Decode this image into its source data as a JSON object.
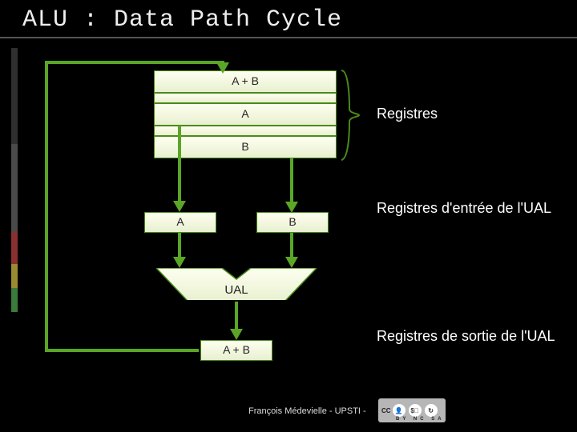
{
  "title": "ALU : Data Path Cycle",
  "registers": {
    "r0": "A + B",
    "r1": "A",
    "r2": "B",
    "label": "Registres"
  },
  "input_regs": {
    "a": "A",
    "b": "B",
    "label": "Registres d'entrée de l'UAL"
  },
  "ual": {
    "label": "UAL"
  },
  "output_reg": {
    "value": "A + B",
    "label": "Registres de sortie de l'UAL"
  },
  "footer": "François Médevielle - UPSTI -",
  "cc": {
    "prefix": "CC",
    "terms": "BY NC SA"
  },
  "colors": {
    "green": "#5aa626",
    "green_line": "#4a8a1a"
  },
  "chart_data": {
    "type": "diagram",
    "title": "ALU : Data Path Cycle",
    "nodes": [
      {
        "id": "regfile",
        "label": "Registres",
        "rows": [
          "A + B",
          "A",
          "B"
        ]
      },
      {
        "id": "inA",
        "label": "A",
        "group": "Registres d'entrée de l'UAL"
      },
      {
        "id": "inB",
        "label": "B",
        "group": "Registres d'entrée de l'UAL"
      },
      {
        "id": "UAL",
        "label": "UAL"
      },
      {
        "id": "out",
        "label": "A + B",
        "group": "Registres de sortie de l'UAL"
      }
    ],
    "edges": [
      {
        "from": "regfile.A",
        "to": "inA"
      },
      {
        "from": "regfile.B",
        "to": "inB"
      },
      {
        "from": "inA",
        "to": "UAL"
      },
      {
        "from": "inB",
        "to": "UAL"
      },
      {
        "from": "UAL",
        "to": "out"
      },
      {
        "from": "out",
        "to": "regfile.A+B",
        "note": "write-back"
      }
    ]
  }
}
